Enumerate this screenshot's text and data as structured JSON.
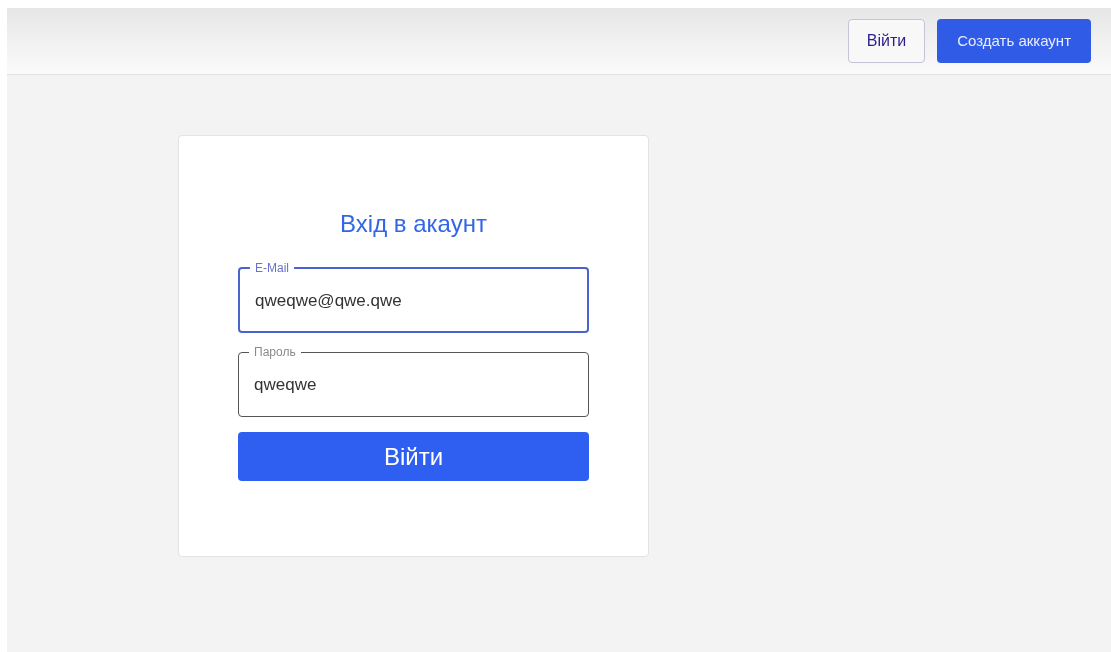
{
  "header": {
    "buttons": [
      {
        "label": "Війти",
        "kind": "outline"
      },
      {
        "label": "Создать аккаунт",
        "kind": "primary"
      }
    ]
  },
  "login_card": {
    "title": "Вхід в акаунт",
    "fields": [
      {
        "label": "E-Mail",
        "value": "qweqwe@qwe.qwe",
        "focused": true
      },
      {
        "label": "Пароль",
        "value": "qweqwe",
        "focused": false
      }
    ],
    "submit": "Війти"
  }
}
